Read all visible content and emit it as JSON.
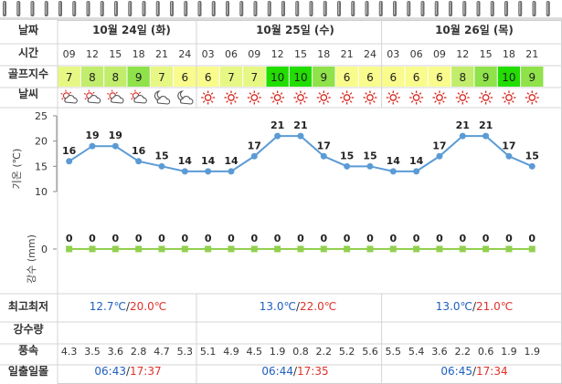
{
  "labels": {
    "date": "날짜",
    "time": "시간",
    "golf_index": "골프지수",
    "weather": "날씨",
    "minmax": "최고최저",
    "rainfall": "강수량",
    "wind": "풍속",
    "sun": "일출일몰"
  },
  "days": [
    {
      "date": "10월 24일 (화)",
      "min": "12.7℃",
      "max": "20.0℃",
      "sunrise": "06:43",
      "sunset": "17:37"
    },
    {
      "date": "10월 25일 (수)",
      "min": "13.0℃",
      "max": "22.0℃",
      "sunrise": "06:44",
      "sunset": "17:35"
    },
    {
      "date": "10월 26일 (목)",
      "min": "13.0℃",
      "max": "21.0℃",
      "sunrise": "06:45",
      "sunset": "17:34"
    }
  ],
  "separator": "/",
  "slots": [
    {
      "time": "09",
      "golf": "7",
      "weather": "partly-cloudy-icon",
      "temp": 16,
      "rain": 0,
      "wind": "4.3"
    },
    {
      "time": "12",
      "golf": "8",
      "weather": "partly-cloudy-icon",
      "temp": 19,
      "rain": 0,
      "wind": "3.5"
    },
    {
      "time": "15",
      "golf": "8",
      "weather": "partly-cloudy-icon",
      "temp": 19,
      "rain": 0,
      "wind": "3.6"
    },
    {
      "time": "18",
      "golf": "9",
      "weather": "partly-cloudy-icon",
      "temp": 16,
      "rain": 0,
      "wind": "2.8"
    },
    {
      "time": "21",
      "golf": "7",
      "weather": "cloudy-night-icon",
      "temp": 15,
      "rain": 0,
      "wind": "4.7"
    },
    {
      "time": "24",
      "golf": "6",
      "weather": "cloudy-night-icon",
      "temp": 14,
      "rain": 0,
      "wind": "5.3"
    },
    {
      "time": "03",
      "golf": "6",
      "weather": "sun-icon",
      "temp": 14,
      "rain": 0,
      "wind": "5.1"
    },
    {
      "time": "06",
      "golf": "7",
      "weather": "sun-icon",
      "temp": 14,
      "rain": 0,
      "wind": "4.9"
    },
    {
      "time": "09",
      "golf": "7",
      "weather": "sun-icon",
      "temp": 17,
      "rain": 0,
      "wind": "4.5"
    },
    {
      "time": "12",
      "golf": "10",
      "weather": "sun-icon",
      "temp": 21,
      "rain": 0,
      "wind": "1.9"
    },
    {
      "time": "15",
      "golf": "10",
      "weather": "sun-icon",
      "temp": 21,
      "rain": 0,
      "wind": "0.8"
    },
    {
      "time": "18",
      "golf": "9",
      "weather": "sun-icon",
      "temp": 17,
      "rain": 0,
      "wind": "2.2"
    },
    {
      "time": "21",
      "golf": "6",
      "weather": "sun-icon",
      "temp": 15,
      "rain": 0,
      "wind": "5.2"
    },
    {
      "time": "24",
      "golf": "6",
      "weather": "sun-icon",
      "temp": 15,
      "rain": 0,
      "wind": "5.6"
    },
    {
      "time": "03",
      "golf": "6",
      "weather": "sun-icon",
      "temp": 14,
      "rain": 0,
      "wind": "5.5"
    },
    {
      "time": "06",
      "golf": "6",
      "weather": "sun-icon",
      "temp": 14,
      "rain": 0,
      "wind": "5.4"
    },
    {
      "time": "09",
      "golf": "6",
      "weather": "sun-icon",
      "temp": 17,
      "rain": 0,
      "wind": "3.6"
    },
    {
      "time": "12",
      "golf": "8",
      "weather": "sun-icon",
      "temp": 21,
      "rain": 0,
      "wind": "2.2"
    },
    {
      "time": "15",
      "golf": "9",
      "weather": "sun-icon",
      "temp": 21,
      "rain": 0,
      "wind": "0.6"
    },
    {
      "time": "18",
      "golf": "10",
      "weather": "sun-icon",
      "temp": 17,
      "rain": 0,
      "wind": "1.9"
    },
    {
      "time": "21",
      "golf": "9",
      "weather": "sun-icon",
      "temp": 15,
      "rain": 0,
      "wind": "1.9"
    }
  ],
  "colors": {
    "golf_10": "#22dd00",
    "golf_9": "#8fe24a",
    "golf_8": "#c2ec6b",
    "golf_7": "#e7f784",
    "golf_6": "#f9fb8c",
    "temp_line": "#5b9bd5",
    "rain_line": "#92d050",
    "max_temp": "#e0302a",
    "min_temp": "#1f5fbf",
    "sun_icon": "#d7281f"
  },
  "chart_data": [
    {
      "type": "line",
      "x": [
        "09",
        "12",
        "15",
        "18",
        "21",
        "24",
        "03",
        "06",
        "09",
        "12",
        "15",
        "18",
        "21",
        "24",
        "03",
        "06",
        "09",
        "12",
        "15",
        "18",
        "21"
      ],
      "series": [
        {
          "values": [
            16,
            19,
            19,
            16,
            15,
            14,
            14,
            14,
            17,
            21,
            21,
            17,
            15,
            15,
            14,
            14,
            17,
            21,
            21,
            17,
            15
          ]
        }
      ],
      "ylabel": "기온 (℃)",
      "yticks": [
        10,
        15,
        20,
        25
      ],
      "ylim": [
        10,
        25
      ],
      "grid": false
    },
    {
      "type": "line",
      "x": [
        "09",
        "12",
        "15",
        "18",
        "21",
        "24",
        "03",
        "06",
        "09",
        "12",
        "15",
        "18",
        "21",
        "24",
        "03",
        "06",
        "09",
        "12",
        "15",
        "18",
        "21"
      ],
      "series": [
        {
          "values": [
            0,
            0,
            0,
            0,
            0,
            0,
            0,
            0,
            0,
            0,
            0,
            0,
            0,
            0,
            0,
            0,
            0,
            0,
            0,
            0,
            0
          ]
        }
      ],
      "ylabel": "강수 (mm)",
      "yticks": [
        0
      ],
      "grid": false
    }
  ]
}
